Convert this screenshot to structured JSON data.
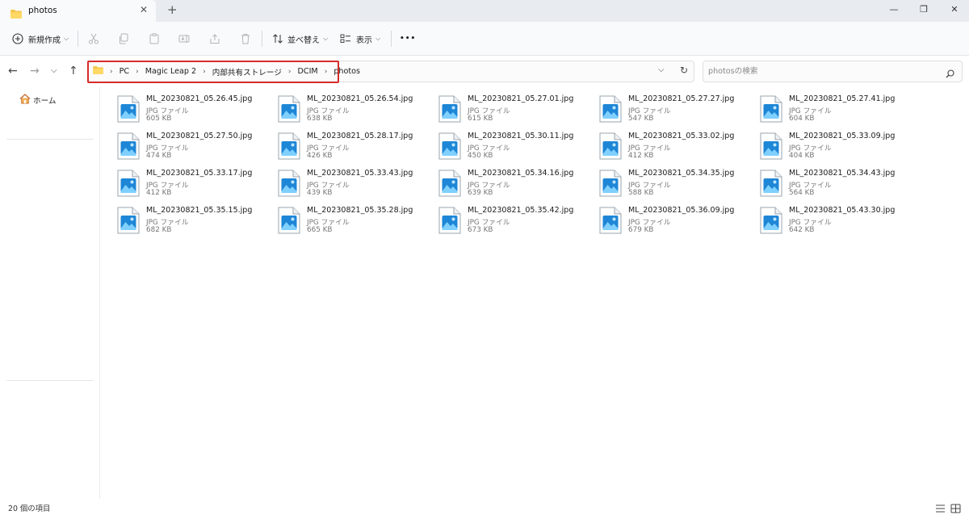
{
  "window": {
    "tab_title": "photos",
    "tab_close": "✕",
    "new_tab": "+",
    "minimize": "—",
    "maximize": "❐",
    "close": "✕"
  },
  "toolbar": {
    "new_label": "新規作成",
    "sort_label": "並べ替え",
    "view_label": "表示",
    "more": "•••"
  },
  "address": {
    "crumbs": [
      "PC",
      "Magic Leap 2",
      "内部共有ストレージ",
      "DCIM",
      "photos"
    ],
    "highlight_color": "#d62b2b"
  },
  "search": {
    "placeholder": "photosの検索"
  },
  "sidebar": {
    "home_label": "ホーム"
  },
  "files": [
    {
      "name": "ML_20230821_05.26.45.jpg",
      "type": "JPG ファイル",
      "size": "605 KB"
    },
    {
      "name": "ML_20230821_05.26.54.jpg",
      "type": "JPG ファイル",
      "size": "638 KB"
    },
    {
      "name": "ML_20230821_05.27.01.jpg",
      "type": "JPG ファイル",
      "size": "615 KB"
    },
    {
      "name": "ML_20230821_05.27.27.jpg",
      "type": "JPG ファイル",
      "size": "547 KB"
    },
    {
      "name": "ML_20230821_05.27.41.jpg",
      "type": "JPG ファイル",
      "size": "604 KB"
    },
    {
      "name": "ML_20230821_05.27.50.jpg",
      "type": "JPG ファイル",
      "size": "474 KB"
    },
    {
      "name": "ML_20230821_05.28.17.jpg",
      "type": "JPG ファイル",
      "size": "426 KB"
    },
    {
      "name": "ML_20230821_05.30.11.jpg",
      "type": "JPG ファイル",
      "size": "450 KB"
    },
    {
      "name": "ML_20230821_05.33.02.jpg",
      "type": "JPG ファイル",
      "size": "412 KB"
    },
    {
      "name": "ML_20230821_05.33.09.jpg",
      "type": "JPG ファイル",
      "size": "404 KB"
    },
    {
      "name": "ML_20230821_05.33.17.jpg",
      "type": "JPG ファイル",
      "size": "412 KB"
    },
    {
      "name": "ML_20230821_05.33.43.jpg",
      "type": "JPG ファイル",
      "size": "439 KB"
    },
    {
      "name": "ML_20230821_05.34.16.jpg",
      "type": "JPG ファイル",
      "size": "639 KB"
    },
    {
      "name": "ML_20230821_05.34.35.jpg",
      "type": "JPG ファイル",
      "size": "588 KB"
    },
    {
      "name": "ML_20230821_05.34.43.jpg",
      "type": "JPG ファイル",
      "size": "564 KB"
    },
    {
      "name": "ML_20230821_05.35.15.jpg",
      "type": "JPG ファイル",
      "size": "682 KB"
    },
    {
      "name": "ML_20230821_05.35.28.jpg",
      "type": "JPG ファイル",
      "size": "665 KB"
    },
    {
      "name": "ML_20230821_05.35.42.jpg",
      "type": "JPG ファイル",
      "size": "673 KB"
    },
    {
      "name": "ML_20230821_05.36.09.jpg",
      "type": "JPG ファイル",
      "size": "679 KB"
    },
    {
      "name": "ML_20230821_05.43.30.jpg",
      "type": "JPG ファイル",
      "size": "642 KB"
    }
  ],
  "status": {
    "item_count": "20 個の項目"
  }
}
